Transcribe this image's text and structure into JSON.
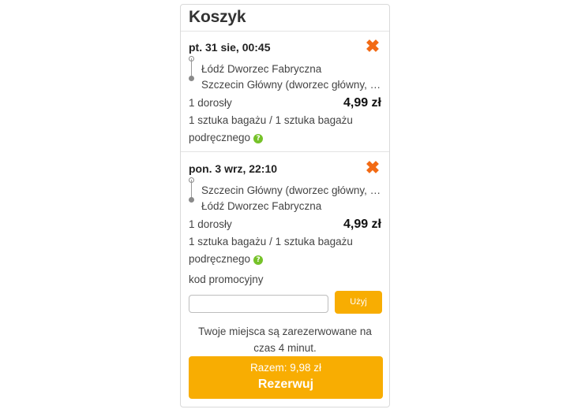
{
  "cart": {
    "title": "Koszyk",
    "trips": [
      {
        "date": "pt. 31 sie, 00:45",
        "from": "Łódź Dworzec Fabryczna",
        "to": "Szczecin Główny (dworzec główny, …",
        "passengers": "1 dorosły",
        "price": "4,99 zł",
        "luggage": "1 sztuka bagażu / 1 sztuka bagażu podręcznego"
      },
      {
        "date": "pon. 3 wrz, 22:10",
        "from": "Szczecin Główny (dworzec główny, …",
        "to": "Łódź Dworzec Fabryczna",
        "passengers": "1 dorosły",
        "price": "4,99 zł",
        "luggage": "1 sztuka bagażu / 1 sztuka bagażu podręcznego"
      }
    ],
    "promo": {
      "label": "kod promocyjny",
      "value": "",
      "apply_label": "Użyj"
    },
    "notice": "Twoje miejsca są zarezerwowane na czas 4 minut.",
    "book": {
      "total": "Razem: 9,98 zł",
      "label": "Rezerwuj"
    }
  },
  "icons": {
    "remove": "close-icon",
    "help": "help-icon",
    "route_start": "route-start-icon",
    "route_end": "route-end-icon"
  },
  "colors": {
    "accent": "#f8ad02",
    "remove": "#f26a14",
    "help": "#76c229"
  }
}
